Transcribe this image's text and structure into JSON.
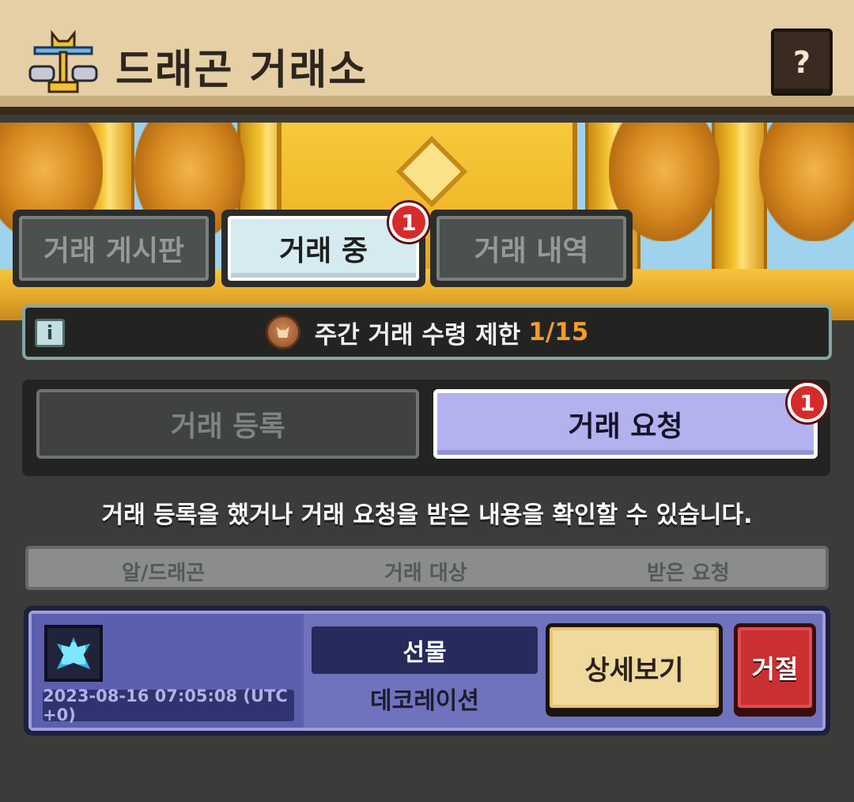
{
  "header": {
    "title": "드래곤 거래소",
    "help_label": "?"
  },
  "top_tabs": [
    {
      "label": "거래 게시판",
      "active": false
    },
    {
      "label": "거래 중",
      "active": true,
      "badge": "1"
    },
    {
      "label": "거래 내역",
      "active": false
    }
  ],
  "weekly_limit": {
    "label": "주간 거래 수령 제한",
    "value": "1/15",
    "value_color": "#f39b2c"
  },
  "sub_tabs": [
    {
      "label": "거래 등록",
      "active": false
    },
    {
      "label": "거래 요청",
      "active": true,
      "badge": "1"
    }
  ],
  "description": "거래 등록을 했거나 거래 요청을 받은 내용을 확인할 수 있습니다.",
  "columns": [
    "알/드래곤",
    "거래 대상",
    "받은 요청"
  ],
  "trades": [
    {
      "item_icon": "crystal-icon",
      "timestamp": "2023-08-16 07:05:08 (UTC +0)",
      "type": "선물",
      "target": "데코레이션",
      "detail_label": "상세보기",
      "reject_label": "거절"
    }
  ]
}
